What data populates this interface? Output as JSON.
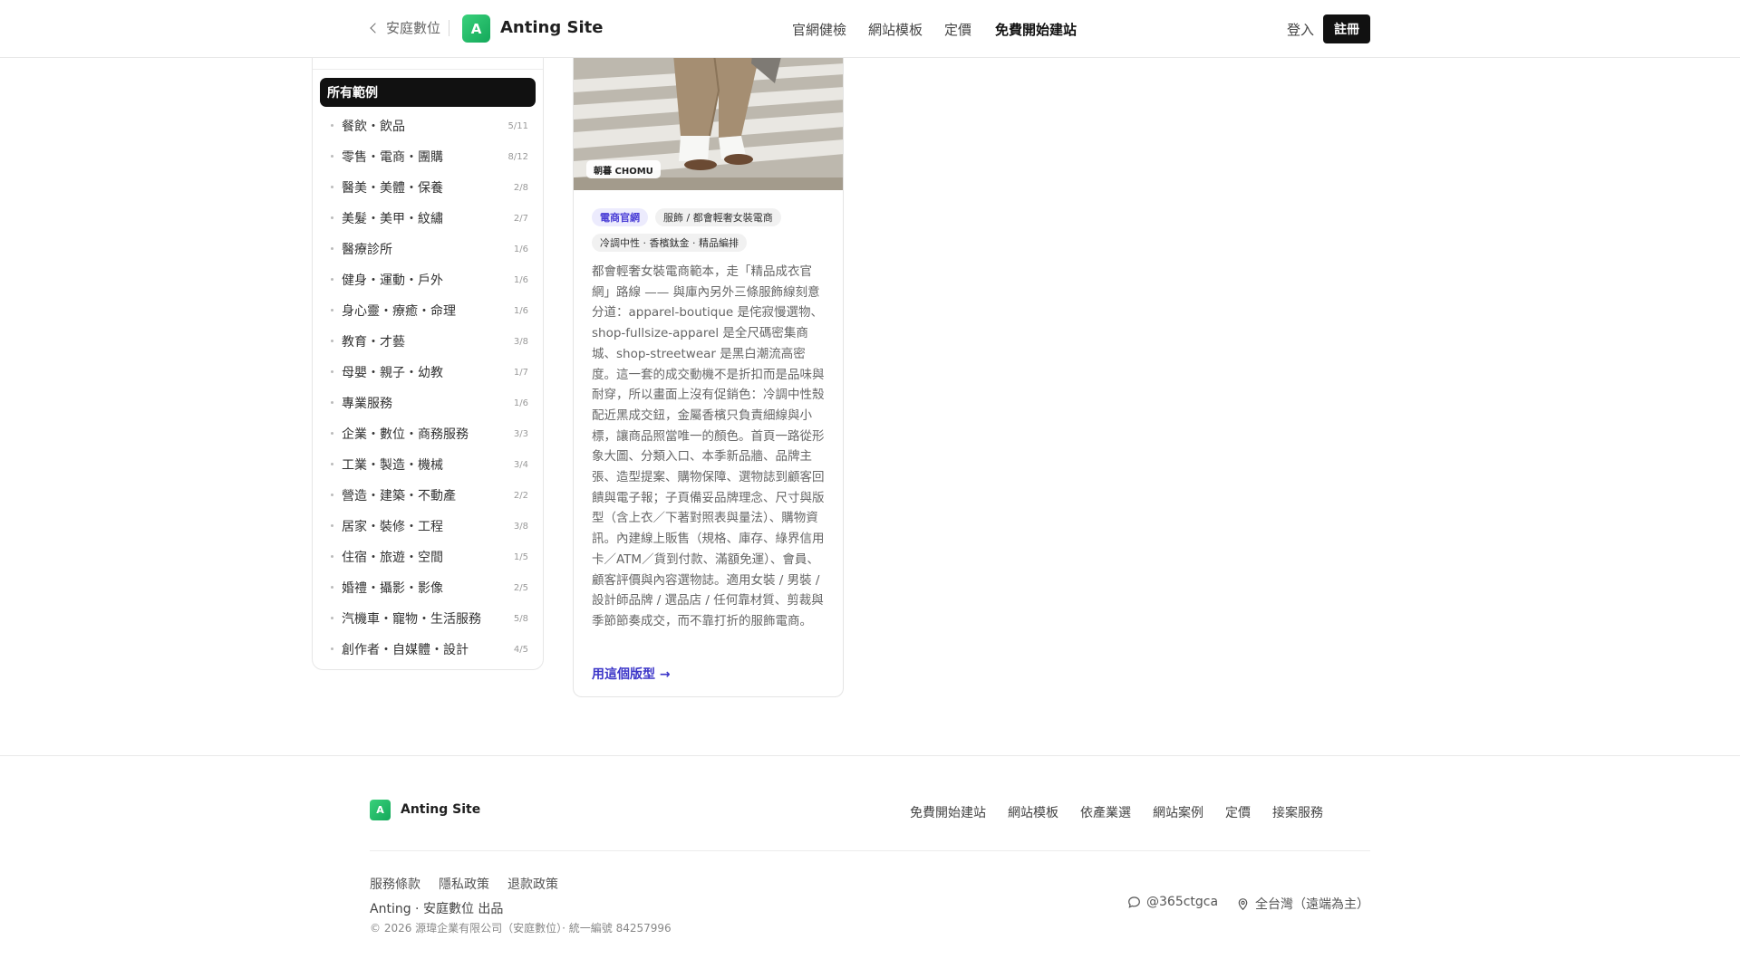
{
  "header": {
    "back_label": "安庭數位",
    "logo_letter": "A",
    "brand": "Anting Site",
    "nav": [
      "官網健檢",
      "網站模板",
      "定價",
      "免費開始建站"
    ],
    "login": "登入",
    "register": "註冊"
  },
  "sidebar": {
    "active": "所有範例",
    "items": [
      {
        "label": "餐飲・飲品",
        "count": "5/11"
      },
      {
        "label": "零售・電商・團購",
        "count": "8/12"
      },
      {
        "label": "醫美・美體・保養",
        "count": "2/8"
      },
      {
        "label": "美髮・美甲・紋繡",
        "count": "2/7"
      },
      {
        "label": "醫療診所",
        "count": "1/6"
      },
      {
        "label": "健身・運動・戶外",
        "count": "1/6"
      },
      {
        "label": "身心靈・療癒・命理",
        "count": "1/6"
      },
      {
        "label": "教育・才藝",
        "count": "3/8"
      },
      {
        "label": "母嬰・親子・幼教",
        "count": "1/7"
      },
      {
        "label": "專業服務",
        "count": "1/6"
      },
      {
        "label": "企業・數位・商務服務",
        "count": "3/3"
      },
      {
        "label": "工業・製造・機械",
        "count": "3/4"
      },
      {
        "label": "營造・建築・不動產",
        "count": "2/2"
      },
      {
        "label": "居家・裝修・工程",
        "count": "3/8"
      },
      {
        "label": "住宿・旅遊・空間",
        "count": "1/5"
      },
      {
        "label": "婚禮・攝影・影像",
        "count": "2/5"
      },
      {
        "label": "汽機車・寵物・生活服務",
        "count": "5/8"
      },
      {
        "label": "創作者・自媒體・設計",
        "count": "4/5"
      }
    ]
  },
  "card": {
    "image_tag": "朝暮 CHOMU",
    "tags": [
      "電商官網",
      "服飾 / 都會輕奢女裝電商",
      "冷調中性 · 香檳鈦金 · 精品編排"
    ],
    "description": "都會輕奢女裝電商範本，走「精品成衣官網」路線 —— 與庫內另外三條服飾線刻意分道：apparel-boutique 是侘寂慢選物、shop-fullsize-apparel 是全尺碼密集商城、shop-streetwear 是黑白潮流高密度。這一套的成交動機不是折扣而是品味與耐穿，所以畫面上沒有促銷色：冷調中性殼配近黑成交鈕，金屬香檳只負責細線與小標，讓商品照當唯一的顏色。首頁一路從形象大圖、分類入口、本季新品牆、品牌主張、造型提案、購物保障、選物誌到顧客回饋與電子報；子頁備妥品牌理念、尺寸與版型（含上衣／下著對照表與量法）、購物資訊。內建線上販售（規格、庫存、綠界信用卡／ATM／貨到付款、滿額免運）、會員、顧客評價與內容選物誌。適用女裝 / 男裝 / 設計師品牌 / 選品店 / 任何靠材質、剪裁與季節節奏成交，而不靠打折的服飾電商。",
    "cta": "用這個版型 →"
  },
  "footer": {
    "logo_letter": "A",
    "brand": "Anting Site",
    "nav": [
      "免費開始建站",
      "網站模板",
      "依產業選",
      "網站案例",
      "定價",
      "接案服務"
    ],
    "legal": [
      "服務條款",
      "隱私政策",
      "退款政策"
    ],
    "credit": "Anting · 安庭數位 出品",
    "copyright": "© 2026 源瑋企業有限公司（安庭數位）· 統一編號 84257996",
    "line_id": "@365ctgca",
    "location": "全台灣（遠端為主）"
  },
  "colors": {
    "accent": "#3b35c8",
    "brand_green": "#1fbf6a",
    "dark": "#111111"
  }
}
